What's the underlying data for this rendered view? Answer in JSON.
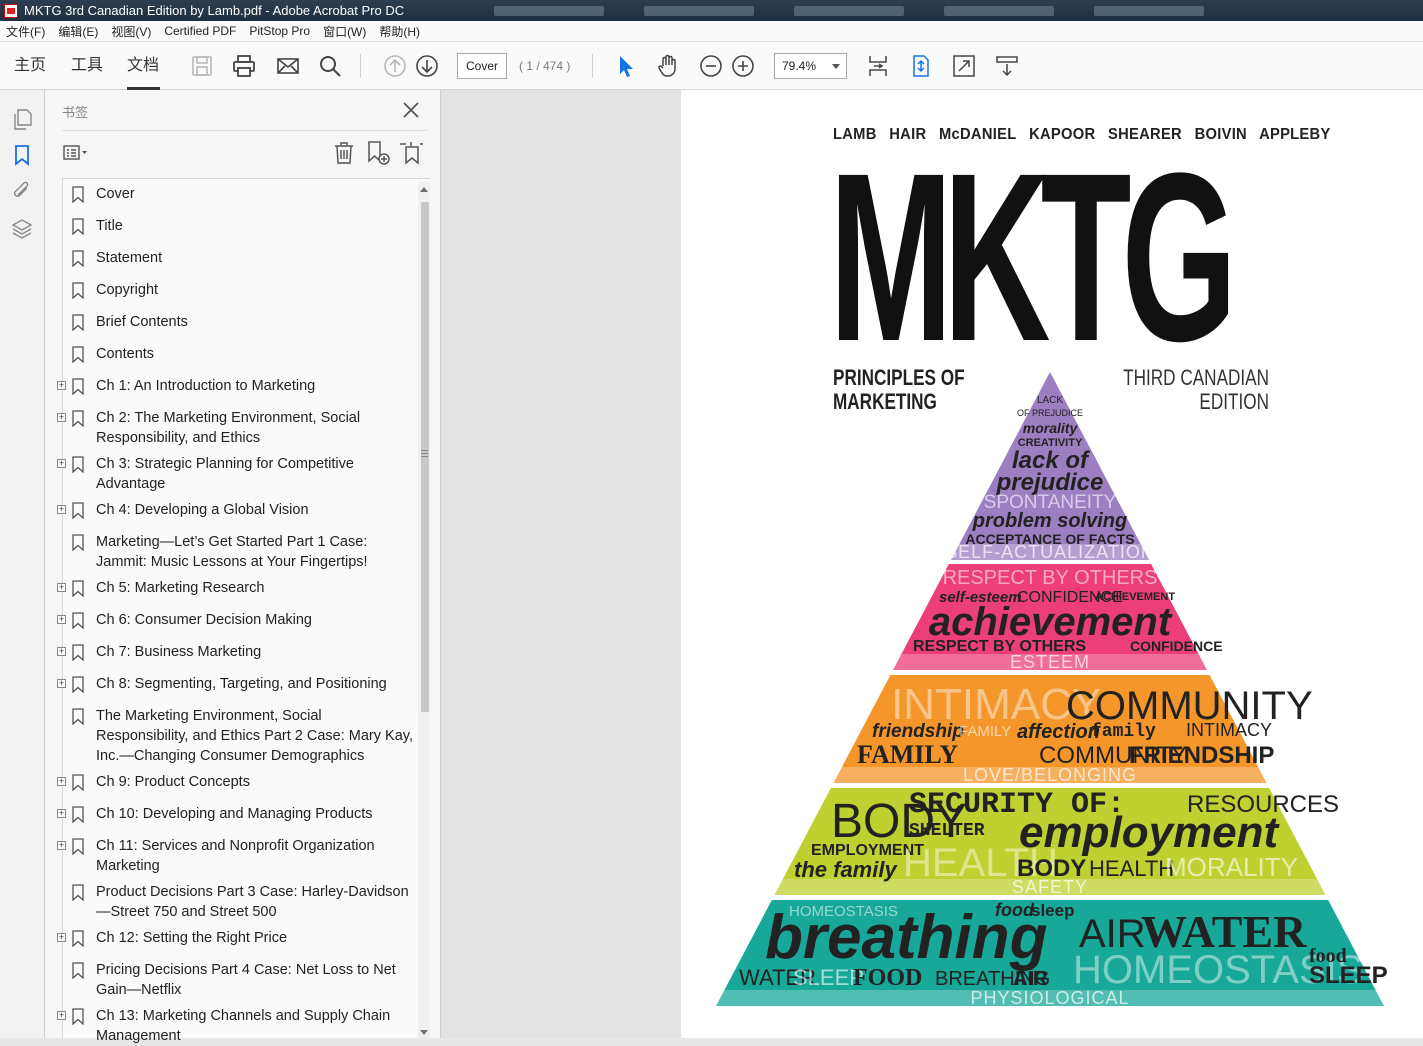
{
  "window": {
    "title": "MKTG 3rd Canadian Edition by Lamb.pdf - Adobe Acrobat Pro DC"
  },
  "menu": [
    "文件(F)",
    "编辑(E)",
    "视图(V)",
    "Certified PDF",
    "PitStop Pro",
    "窗口(W)",
    "帮助(H)"
  ],
  "tabs": {
    "home": "主页",
    "tools": "工具",
    "document": "文档"
  },
  "toolbar": {
    "page_field": "Cover",
    "page_count": "( 1 / 474 )",
    "zoom": "79.4%"
  },
  "panel": {
    "title": "书签"
  },
  "bookmarks": [
    {
      "label": "Cover",
      "expandable": false
    },
    {
      "label": "Title",
      "expandable": false
    },
    {
      "label": "Statement",
      "expandable": false
    },
    {
      "label": "Copyright",
      "expandable": false
    },
    {
      "label": "Brief Contents",
      "expandable": false
    },
    {
      "label": "Contents",
      "expandable": false
    },
    {
      "label": "Ch 1: An Introduction to Marketing",
      "expandable": true
    },
    {
      "label": "Ch 2: The Marketing Environment, Social Responsibility, and Ethics",
      "expandable": true
    },
    {
      "label": "Ch 3: Strategic Planning for Competitive Advantage",
      "expandable": true
    },
    {
      "label": "Ch 4: Developing a Global Vision",
      "expandable": true
    },
    {
      "label": "Marketing—Let’s Get Started Part 1 Case: Jammit: Music Lessons at Your Fingertips!",
      "expandable": false
    },
    {
      "label": "Ch 5: Marketing Research",
      "expandable": true
    },
    {
      "label": "Ch 6: Consumer Decision Making",
      "expandable": true
    },
    {
      "label": "Ch 7: Business Marketing",
      "expandable": true
    },
    {
      "label": "Ch 8: Segmenting, Targeting, and Positioning",
      "expandable": true
    },
    {
      "label": "The Marketing Environment, Social Responsibility, and Ethics Part 2 Case: Mary Kay, Inc.—Changing Consumer Demographics",
      "expandable": false
    },
    {
      "label": "Ch 9: Product Concepts",
      "expandable": true
    },
    {
      "label": "Ch 10: Developing and Managing Products",
      "expandable": true
    },
    {
      "label": "Ch 11: Services and Nonprofit Organization Marketing",
      "expandable": true
    },
    {
      "label": "Product Decisions Part 3 Case: Harley-Davidson—Street 750 and Street 500",
      "expandable": false
    },
    {
      "label": "Ch 12: Setting the Right Price",
      "expandable": true
    },
    {
      "label": "Pricing Decisions Part 4 Case: Net Loss to Net Gain—Netflix",
      "expandable": false
    },
    {
      "label": "Ch 13: Marketing Channels and Supply Chain Management",
      "expandable": true
    }
  ],
  "cover": {
    "authors": [
      "LAMB",
      "HAIR",
      "McDANIEL",
      "KAPOOR",
      "SHEARER",
      "BOIVIN",
      "APPLEBY"
    ],
    "title": "MKTG",
    "subtitle_line1": "PRINCIPLES OF",
    "subtitle_line2": "MARKETING",
    "edition_line1": "THIRD CANADIAN",
    "edition_line2": "EDITION",
    "pyramid": {
      "top": {
        "color": "#9b7fc0",
        "label": "SELF-ACTUALIZATION",
        "words": [
          "LACK",
          "OF PREJUDICE",
          "morality",
          "CREATIVITY",
          "lack of",
          "prejudice",
          "SPONTANEITY",
          "problem solving",
          "ACCEPTANCE OF FACTS"
        ]
      },
      "esteem": {
        "color": "#ec3e78",
        "label": "ESTEEM",
        "words": [
          "RESPECT BY OTHERS",
          "self-esteem",
          "CONFIDENCE",
          "ACHIEVEMENT",
          "achievement",
          "RESPECT BY OTHERS",
          "CONFIDENCE"
        ]
      },
      "love": {
        "color": "#f5962a",
        "label": "LOVE/BELONGING",
        "words": [
          "INTIMACY",
          "COMMUNITY",
          "friendship",
          "FAMILY",
          "affection",
          "family",
          "INTIMACY",
          "FAMILY",
          "COMMUNITY",
          "FRIENDSHIP"
        ]
      },
      "safety": {
        "color": "#bfd131",
        "label": "SAFETY",
        "words": [
          "BODY",
          "SECURITY OF:",
          "RESOURCES",
          "SHELTER",
          "employment",
          "EMPLOYMENT",
          "the family",
          "HEALTH",
          "BODY",
          "HEALTH",
          "MORALITY"
        ]
      },
      "physio": {
        "color": "#18a89a",
        "label": "PHYSIOLOGICAL",
        "words": [
          "HOMEOSTASIS",
          "food",
          "sleep",
          "breathing",
          "AIR",
          "WATER",
          "WATER",
          "SLEEP",
          "FOOD",
          "BREATHING",
          "AIR",
          "HOMEOSTASIS",
          "food",
          "SLEEP"
        ]
      }
    }
  }
}
